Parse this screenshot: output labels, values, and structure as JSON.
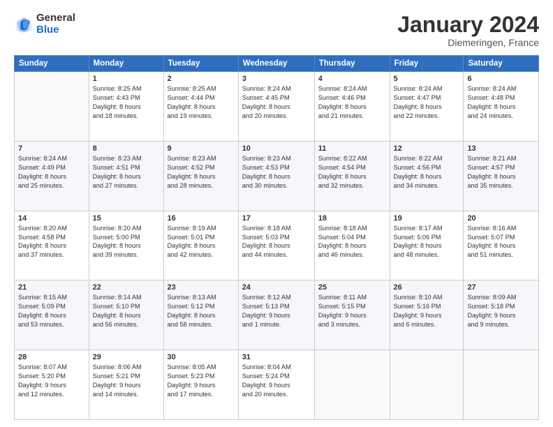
{
  "logo": {
    "general": "General",
    "blue": "Blue"
  },
  "header": {
    "month": "January 2024",
    "location": "Diemeringen, France"
  },
  "columns": [
    "Sunday",
    "Monday",
    "Tuesday",
    "Wednesday",
    "Thursday",
    "Friday",
    "Saturday"
  ],
  "weeks": [
    [
      {
        "day": "",
        "info": ""
      },
      {
        "day": "1",
        "info": "Sunrise: 8:25 AM\nSunset: 4:43 PM\nDaylight: 8 hours\nand 18 minutes."
      },
      {
        "day": "2",
        "info": "Sunrise: 8:25 AM\nSunset: 4:44 PM\nDaylight: 8 hours\nand 19 minutes."
      },
      {
        "day": "3",
        "info": "Sunrise: 8:24 AM\nSunset: 4:45 PM\nDaylight: 8 hours\nand 20 minutes."
      },
      {
        "day": "4",
        "info": "Sunrise: 8:24 AM\nSunset: 4:46 PM\nDaylight: 8 hours\nand 21 minutes."
      },
      {
        "day": "5",
        "info": "Sunrise: 8:24 AM\nSunset: 4:47 PM\nDaylight: 8 hours\nand 22 minutes."
      },
      {
        "day": "6",
        "info": "Sunrise: 8:24 AM\nSunset: 4:48 PM\nDaylight: 8 hours\nand 24 minutes."
      }
    ],
    [
      {
        "day": "7",
        "info": "Sunrise: 8:24 AM\nSunset: 4:49 PM\nDaylight: 8 hours\nand 25 minutes."
      },
      {
        "day": "8",
        "info": "Sunrise: 8:23 AM\nSunset: 4:51 PM\nDaylight: 8 hours\nand 27 minutes."
      },
      {
        "day": "9",
        "info": "Sunrise: 8:23 AM\nSunset: 4:52 PM\nDaylight: 8 hours\nand 28 minutes."
      },
      {
        "day": "10",
        "info": "Sunrise: 8:23 AM\nSunset: 4:53 PM\nDaylight: 8 hours\nand 30 minutes."
      },
      {
        "day": "11",
        "info": "Sunrise: 8:22 AM\nSunset: 4:54 PM\nDaylight: 8 hours\nand 32 minutes."
      },
      {
        "day": "12",
        "info": "Sunrise: 8:22 AM\nSunset: 4:56 PM\nDaylight: 8 hours\nand 34 minutes."
      },
      {
        "day": "13",
        "info": "Sunrise: 8:21 AM\nSunset: 4:57 PM\nDaylight: 8 hours\nand 35 minutes."
      }
    ],
    [
      {
        "day": "14",
        "info": "Sunrise: 8:20 AM\nSunset: 4:58 PM\nDaylight: 8 hours\nand 37 minutes."
      },
      {
        "day": "15",
        "info": "Sunrise: 8:20 AM\nSunset: 5:00 PM\nDaylight: 8 hours\nand 39 minutes."
      },
      {
        "day": "16",
        "info": "Sunrise: 8:19 AM\nSunset: 5:01 PM\nDaylight: 8 hours\nand 42 minutes."
      },
      {
        "day": "17",
        "info": "Sunrise: 8:18 AM\nSunset: 5:03 PM\nDaylight: 8 hours\nand 44 minutes."
      },
      {
        "day": "18",
        "info": "Sunrise: 8:18 AM\nSunset: 5:04 PM\nDaylight: 8 hours\nand 46 minutes."
      },
      {
        "day": "19",
        "info": "Sunrise: 8:17 AM\nSunset: 5:06 PM\nDaylight: 8 hours\nand 48 minutes."
      },
      {
        "day": "20",
        "info": "Sunrise: 8:16 AM\nSunset: 5:07 PM\nDaylight: 8 hours\nand 51 minutes."
      }
    ],
    [
      {
        "day": "21",
        "info": "Sunrise: 8:15 AM\nSunset: 5:09 PM\nDaylight: 8 hours\nand 53 minutes."
      },
      {
        "day": "22",
        "info": "Sunrise: 8:14 AM\nSunset: 5:10 PM\nDaylight: 8 hours\nand 56 minutes."
      },
      {
        "day": "23",
        "info": "Sunrise: 8:13 AM\nSunset: 5:12 PM\nDaylight: 8 hours\nand 58 minutes."
      },
      {
        "day": "24",
        "info": "Sunrise: 8:12 AM\nSunset: 5:13 PM\nDaylight: 9 hours\nand 1 minute."
      },
      {
        "day": "25",
        "info": "Sunrise: 8:11 AM\nSunset: 5:15 PM\nDaylight: 9 hours\nand 3 minutes."
      },
      {
        "day": "26",
        "info": "Sunrise: 8:10 AM\nSunset: 5:16 PM\nDaylight: 9 hours\nand 6 minutes."
      },
      {
        "day": "27",
        "info": "Sunrise: 8:09 AM\nSunset: 5:18 PM\nDaylight: 9 hours\nand 9 minutes."
      }
    ],
    [
      {
        "day": "28",
        "info": "Sunrise: 8:07 AM\nSunset: 5:20 PM\nDaylight: 9 hours\nand 12 minutes."
      },
      {
        "day": "29",
        "info": "Sunrise: 8:06 AM\nSunset: 5:21 PM\nDaylight: 9 hours\nand 14 minutes."
      },
      {
        "day": "30",
        "info": "Sunrise: 8:05 AM\nSunset: 5:23 PM\nDaylight: 9 hours\nand 17 minutes."
      },
      {
        "day": "31",
        "info": "Sunrise: 8:04 AM\nSunset: 5:24 PM\nDaylight: 9 hours\nand 20 minutes."
      },
      {
        "day": "",
        "info": ""
      },
      {
        "day": "",
        "info": ""
      },
      {
        "day": "",
        "info": ""
      }
    ]
  ]
}
